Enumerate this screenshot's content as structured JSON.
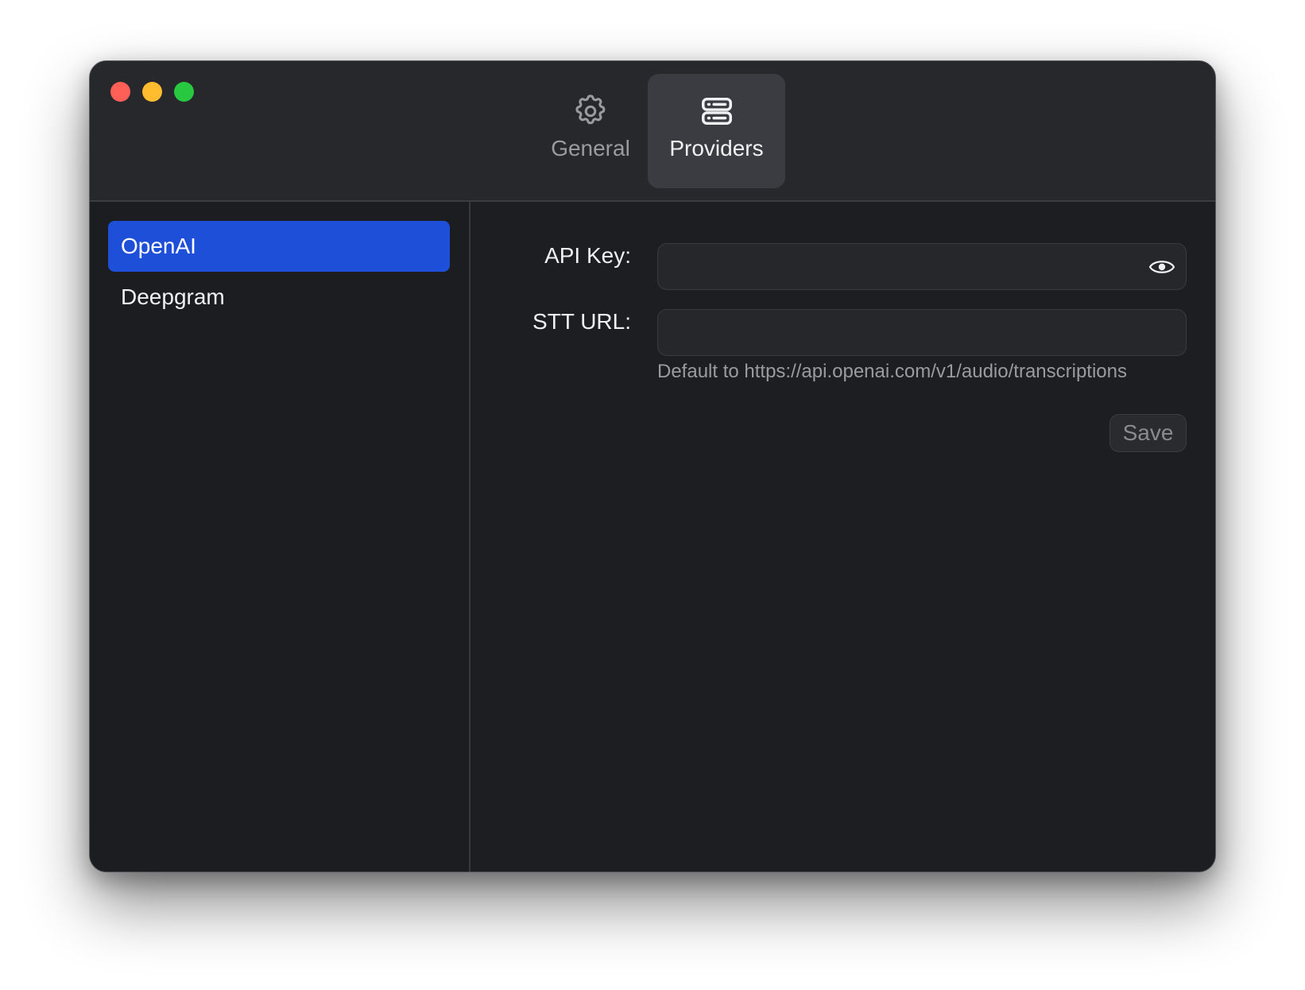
{
  "window": {
    "tabs": [
      {
        "label": "General",
        "icon": "gear-icon",
        "selected": false
      },
      {
        "label": "Providers",
        "icon": "server-icon",
        "selected": true
      }
    ]
  },
  "sidebar": {
    "items": [
      {
        "label": "OpenAI",
        "selected": true
      },
      {
        "label": "Deepgram",
        "selected": false
      }
    ]
  },
  "form": {
    "api_key": {
      "label": "API Key:",
      "value": "",
      "placeholder": "",
      "toggle_icon": "eye-icon"
    },
    "stt_url": {
      "label": "STT URL:",
      "value": "",
      "placeholder": ""
    },
    "hint": "Default to https://api.openai.com/v1/audio/transcriptions",
    "save_label": "Save"
  },
  "colors": {
    "accent": "#1d4fd8",
    "close": "#fe5f57",
    "minimize": "#febc2e",
    "maximize": "#28c840"
  }
}
